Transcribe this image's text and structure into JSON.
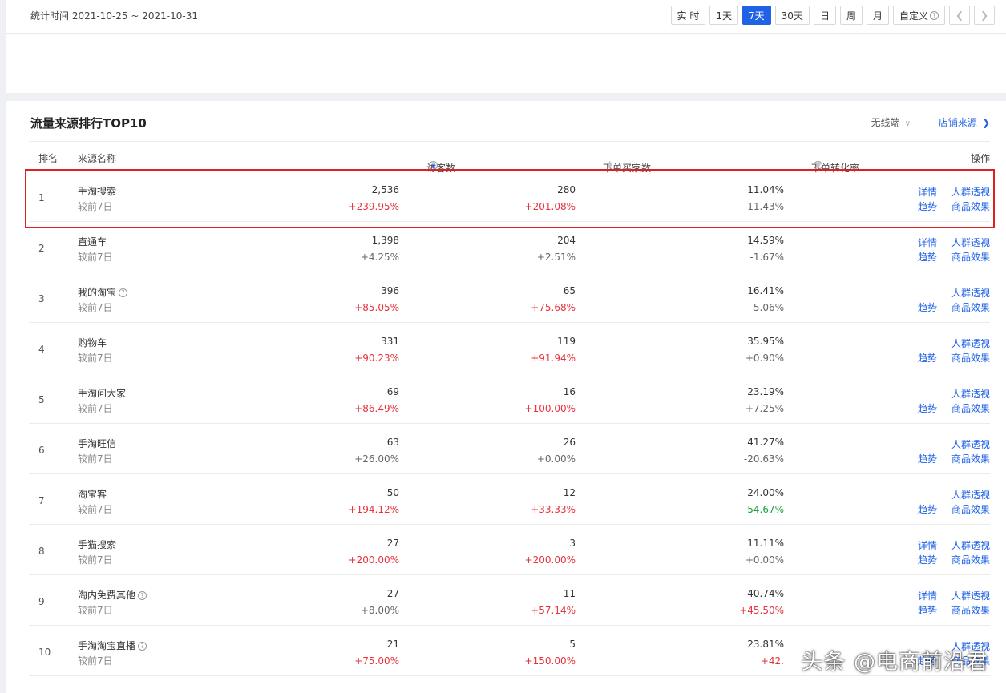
{
  "filter": {
    "stat_time": "统计时间 2021-10-25 ~ 2021-10-31",
    "buttons": [
      "实 时",
      "1天",
      "7天",
      "30天",
      "日",
      "周",
      "月"
    ],
    "custom_label": "自定义",
    "active": "7天"
  },
  "card": {
    "title": "流量来源排行TOP10",
    "device": "无线端",
    "store_source": "店铺来源"
  },
  "headers": {
    "rank": "排名",
    "source": "来源名称",
    "visitors": "访客数",
    "buyers": "下单买家数",
    "conversion": "下单转化率",
    "ops": "操作"
  },
  "compare_label": "较前7日",
  "ops_labels": {
    "detail": "详情",
    "crowd": "人群透视",
    "trend": "趋势",
    "goods": "商品效果"
  },
  "rows": [
    {
      "rank": "1",
      "name": "手淘搜索",
      "help": false,
      "visitors": "2,536",
      "visitors_chg": "+239.95%",
      "visitors_cls": "up",
      "buyers": "280",
      "buyers_chg": "+201.08%",
      "buyers_cls": "up",
      "conv": "11.04%",
      "conv_chg": "-11.43%",
      "conv_cls": "neutral",
      "detail": true
    },
    {
      "rank": "2",
      "name": "直通车",
      "help": false,
      "visitors": "1,398",
      "visitors_chg": "+4.25%",
      "visitors_cls": "neutral",
      "buyers": "204",
      "buyers_chg": "+2.51%",
      "buyers_cls": "neutral",
      "conv": "14.59%",
      "conv_chg": "-1.67%",
      "conv_cls": "neutral",
      "detail": true
    },
    {
      "rank": "3",
      "name": "我的淘宝",
      "help": true,
      "visitors": "396",
      "visitors_chg": "+85.05%",
      "visitors_cls": "up",
      "buyers": "65",
      "buyers_chg": "+75.68%",
      "buyers_cls": "up",
      "conv": "16.41%",
      "conv_chg": "-5.06%",
      "conv_cls": "neutral",
      "detail": false
    },
    {
      "rank": "4",
      "name": "购物车",
      "help": false,
      "visitors": "331",
      "visitors_chg": "+90.23%",
      "visitors_cls": "up",
      "buyers": "119",
      "buyers_chg": "+91.94%",
      "buyers_cls": "up",
      "conv": "35.95%",
      "conv_chg": "+0.90%",
      "conv_cls": "neutral",
      "detail": false
    },
    {
      "rank": "5",
      "name": "手淘问大家",
      "help": false,
      "visitors": "69",
      "visitors_chg": "+86.49%",
      "visitors_cls": "up",
      "buyers": "16",
      "buyers_chg": "+100.00%",
      "buyers_cls": "up",
      "conv": "23.19%",
      "conv_chg": "+7.25%",
      "conv_cls": "neutral",
      "detail": false
    },
    {
      "rank": "6",
      "name": "手淘旺信",
      "help": false,
      "visitors": "63",
      "visitors_chg": "+26.00%",
      "visitors_cls": "neutral",
      "buyers": "26",
      "buyers_chg": "+0.00%",
      "buyers_cls": "neutral",
      "conv": "41.27%",
      "conv_chg": "-20.63%",
      "conv_cls": "neutral",
      "detail": false
    },
    {
      "rank": "7",
      "name": "淘宝客",
      "help": false,
      "visitors": "50",
      "visitors_chg": "+194.12%",
      "visitors_cls": "up",
      "buyers": "12",
      "buyers_chg": "+33.33%",
      "buyers_cls": "up",
      "conv": "24.00%",
      "conv_chg": "-54.67%",
      "conv_cls": "down",
      "detail": false
    },
    {
      "rank": "8",
      "name": "手猫搜索",
      "help": false,
      "visitors": "27",
      "visitors_chg": "+200.00%",
      "visitors_cls": "up",
      "buyers": "3",
      "buyers_chg": "+200.00%",
      "buyers_cls": "up",
      "conv": "11.11%",
      "conv_chg": "+0.00%",
      "conv_cls": "neutral",
      "detail": true
    },
    {
      "rank": "9",
      "name": "淘内免费其他",
      "help": true,
      "visitors": "27",
      "visitors_chg": "+8.00%",
      "visitors_cls": "neutral",
      "buyers": "11",
      "buyers_chg": "+57.14%",
      "buyers_cls": "up",
      "conv": "40.74%",
      "conv_chg": "+45.50%",
      "conv_cls": "up",
      "detail": true
    },
    {
      "rank": "10",
      "name": "手淘淘宝直播",
      "help": true,
      "visitors": "21",
      "visitors_chg": "+75.00%",
      "visitors_cls": "up",
      "buyers": "5",
      "buyers_chg": "+150.00%",
      "buyers_cls": "up",
      "conv": "23.81%",
      "conv_chg": "+42.",
      "conv_cls": "up",
      "detail": false
    }
  ],
  "watermark": "头条 @电商前沿君"
}
